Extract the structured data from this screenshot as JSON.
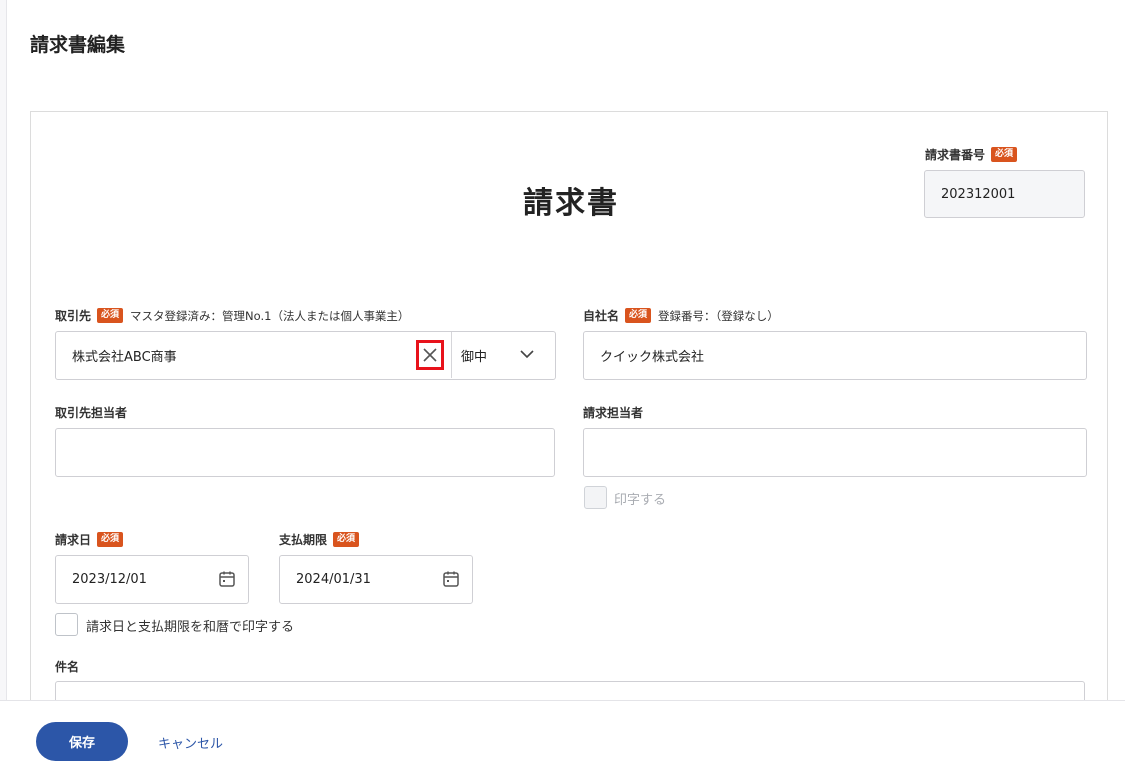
{
  "page": {
    "title": "請求書編集"
  },
  "doc": {
    "title": "請求書"
  },
  "required_badge": "必須",
  "invoice_number": {
    "label": "請求書番号",
    "value": "202312001"
  },
  "client": {
    "label": "取引先",
    "note": "マスタ登録済み：管理No.1（法人または個人事業主）",
    "value": "株式会社ABC商事",
    "honorific": "御中"
  },
  "company": {
    "label": "自社名",
    "note": "登録番号：（登録なし）",
    "value": "クイック株式会社"
  },
  "client_contact": {
    "label": "取引先担当者",
    "value": ""
  },
  "billing_contact": {
    "label": "請求担当者",
    "value": "",
    "print_label": "印字する"
  },
  "billing_date": {
    "label": "請求日",
    "value": "2023/12/01"
  },
  "due_date": {
    "label": "支払期限",
    "value": "2024/01/31"
  },
  "wareki_checkbox_label": "請求日と支払期限を和暦で印字する",
  "subject": {
    "label": "件名"
  },
  "footer": {
    "save_label": "保存",
    "cancel_label": "キャンセル"
  },
  "colors": {
    "required_badge": "#d9541e",
    "primary": "#2c56a8",
    "highlight": "#e8121b"
  },
  "icons": {
    "clear": "close-icon",
    "dropdown": "chevron-down-icon",
    "date": "calendar-icon"
  }
}
